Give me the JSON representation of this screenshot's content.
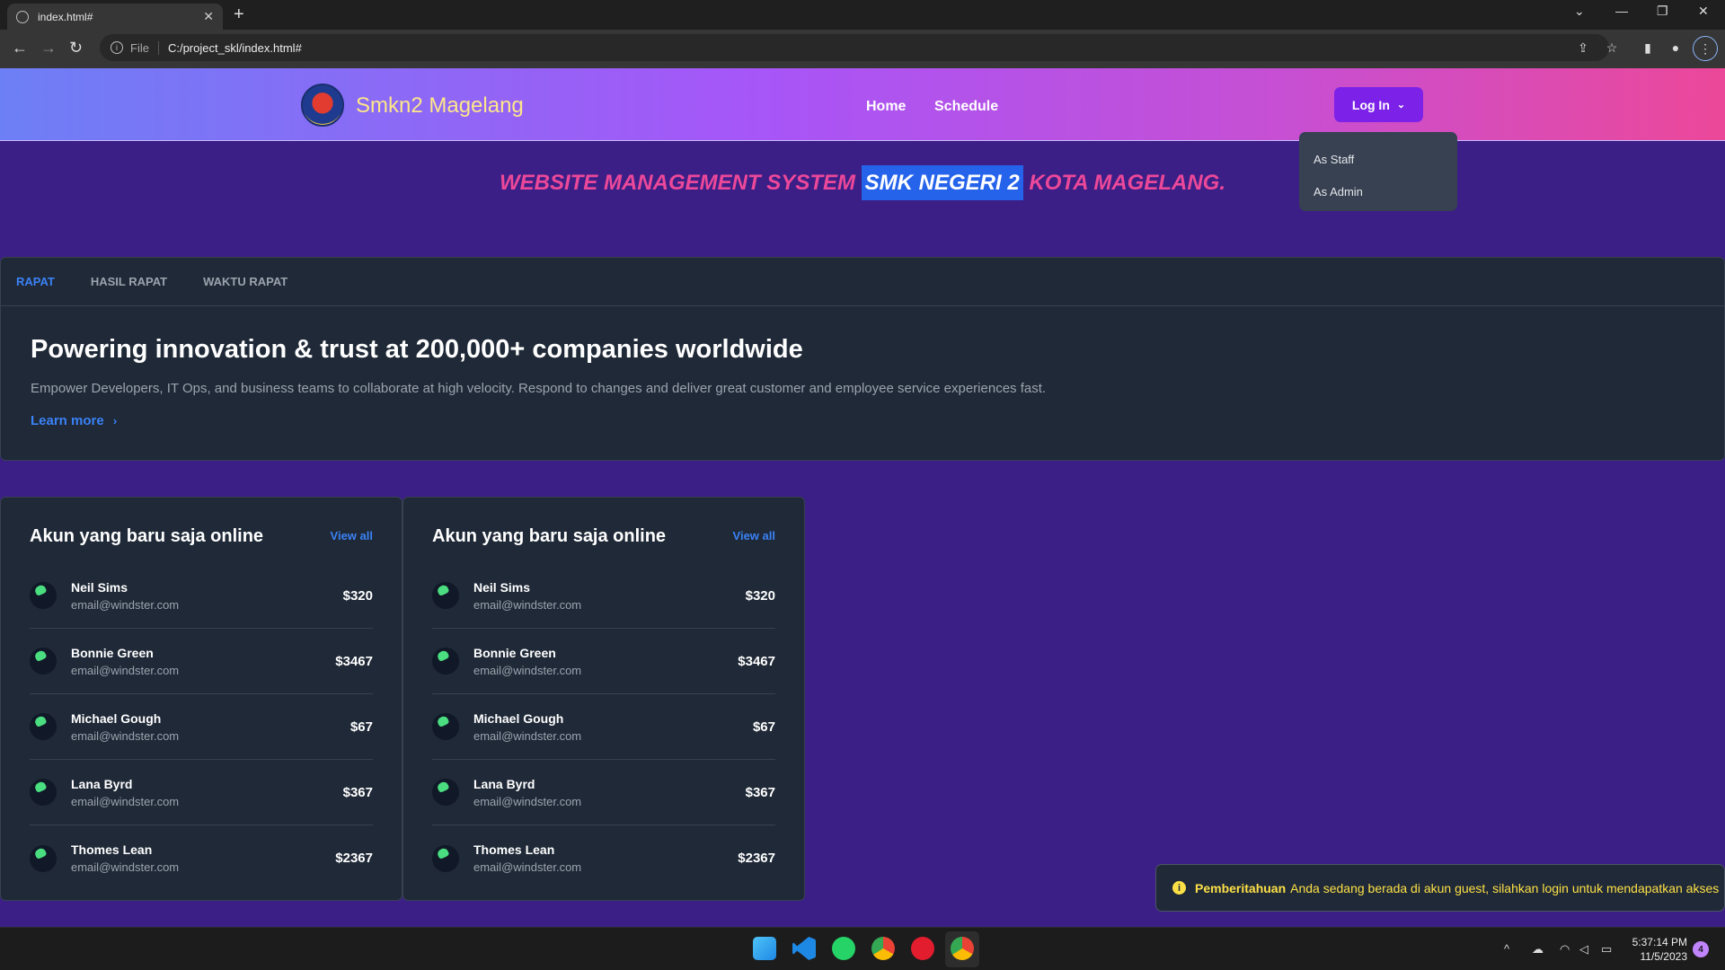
{
  "browser": {
    "tab_title": "index.html#",
    "scheme_label": "File",
    "url": "C:/project_skl/index.html#"
  },
  "header": {
    "brand": "Smkn2 Magelang",
    "nav": {
      "home": "Home",
      "schedule": "Schedule"
    },
    "login_label": "Log In",
    "dropdown": {
      "staff": "As Staff",
      "admin": "As Admin"
    }
  },
  "headline": {
    "before": "WEBSITE MANAGEMENT SYSTEM ",
    "highlight": "SMK NEGERI 2",
    "after": " KOTA MAGELANG."
  },
  "tabs": {
    "t1": "RAPAT",
    "t2": "HASIL RAPAT",
    "t3": "WAKTU RAPAT"
  },
  "hero": {
    "title": "Powering innovation & trust at 200,000+ companies worldwide",
    "text": "Empower Developers, IT Ops, and business teams to collaborate at high velocity. Respond to changes and deliver great customer and employee service experiences fast.",
    "link": "Learn more"
  },
  "lists": [
    {
      "title": "Akun yang baru saja online",
      "view_all": "View all",
      "users": [
        {
          "name": "Neil Sims",
          "email": "email@windster.com",
          "amount": "$320"
        },
        {
          "name": "Bonnie Green",
          "email": "email@windster.com",
          "amount": "$3467"
        },
        {
          "name": "Michael Gough",
          "email": "email@windster.com",
          "amount": "$67"
        },
        {
          "name": "Lana Byrd",
          "email": "email@windster.com",
          "amount": "$367"
        },
        {
          "name": "Thomes Lean",
          "email": "email@windster.com",
          "amount": "$2367"
        }
      ]
    },
    {
      "title": "Akun yang baru saja online",
      "view_all": "View all",
      "users": [
        {
          "name": "Neil Sims",
          "email": "email@windster.com",
          "amount": "$320"
        },
        {
          "name": "Bonnie Green",
          "email": "email@windster.com",
          "amount": "$3467"
        },
        {
          "name": "Michael Gough",
          "email": "email@windster.com",
          "amount": "$67"
        },
        {
          "name": "Lana Byrd",
          "email": "email@windster.com",
          "amount": "$367"
        },
        {
          "name": "Thomes Lean",
          "email": "email@windster.com",
          "amount": "$2367"
        }
      ]
    }
  ],
  "notice": {
    "title": "Pemberitahuan",
    "text": "Anda sedang berada di akun guest, silahkan login untuk mendapatkan akses"
  },
  "taskbar": {
    "time": "5:37:14 PM",
    "date": "11/5/2023",
    "badge": "4"
  },
  "colors": {
    "accent": "#3b82f6",
    "brand": "#fde68a",
    "highlight": "#ec4899",
    "page_bg": "#3b1e86"
  }
}
